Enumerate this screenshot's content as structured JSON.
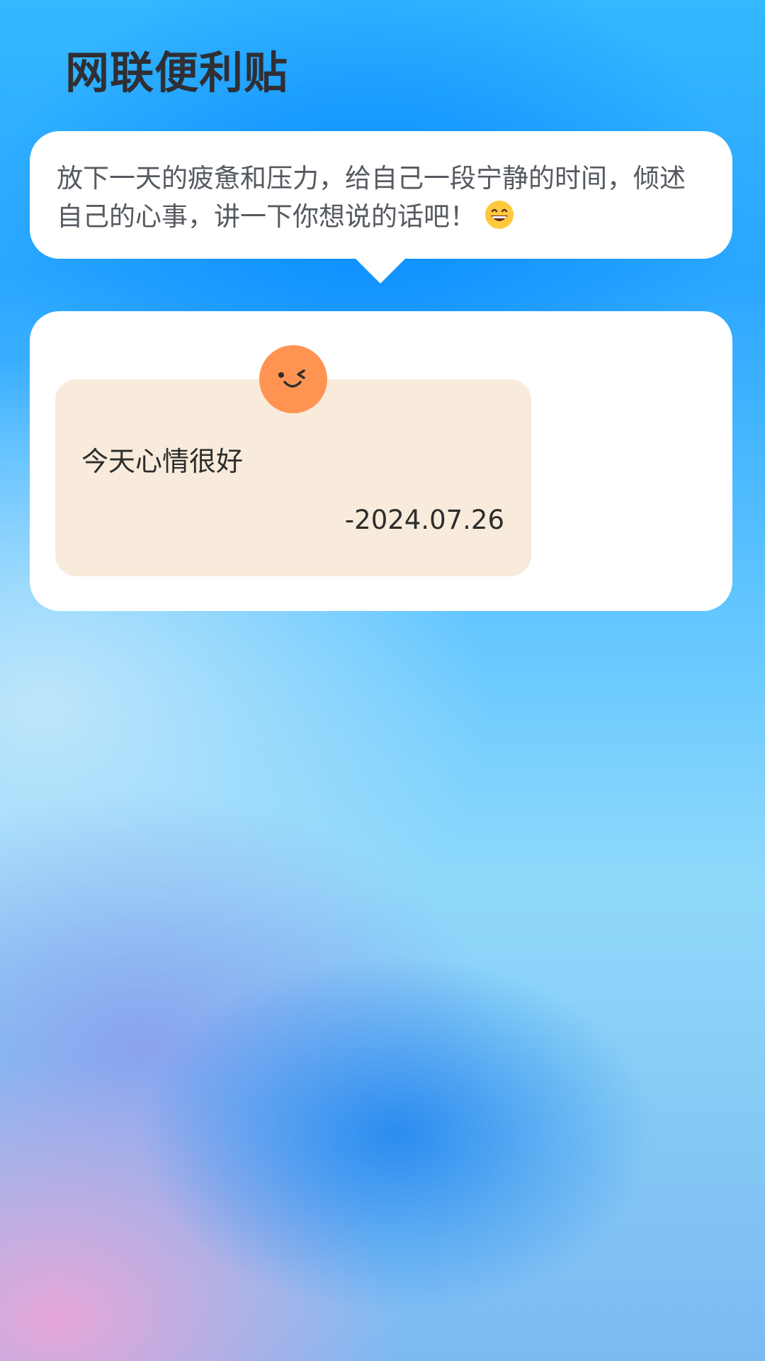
{
  "app": {
    "title": "网联便利贴"
  },
  "prompt_bubble": {
    "text": "放下一天的疲惫和压力，给自己一段宁静的时间，倾述自己的心事，讲一下你想说的话吧！",
    "emoji": "grinning-face-emoji"
  },
  "notes": [
    {
      "mood_icon": "winking-face-icon",
      "mood_color": "#ff9352",
      "text": "今天心情很好",
      "date": "-2024.07.26"
    }
  ],
  "colors": {
    "card_background": "#f8ebdb",
    "title_text": "#2f2f34",
    "bubble_text": "#555a60"
  }
}
